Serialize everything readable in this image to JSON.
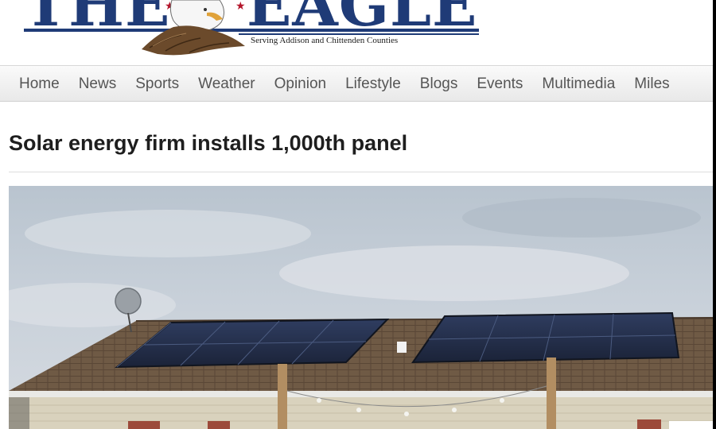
{
  "masthead": {
    "logo_the": "THE",
    "logo_eagle": "EAGLE",
    "tagline": "Serving Addison and Chittenden Counties"
  },
  "nav": {
    "items": [
      "Home",
      "News",
      "Sports",
      "Weather",
      "Opinion",
      "Lifestyle",
      "Blogs",
      "Events",
      "Multimedia",
      "Miles"
    ]
  },
  "article": {
    "headline": "Solar energy firm installs 1,000th panel"
  },
  "colors": {
    "brand_blue": "#1f3b77",
    "brand_red": "#b3152b",
    "nav_text": "#555555"
  }
}
